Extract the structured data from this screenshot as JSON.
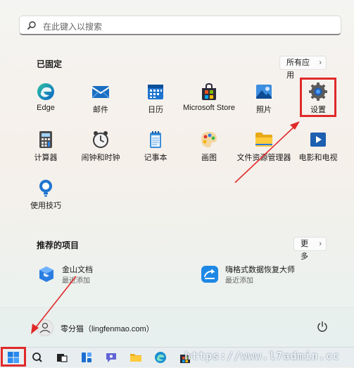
{
  "search": {
    "placeholder": "在此键入以搜索"
  },
  "pinned": {
    "title": "已固定",
    "all_apps_label": "所有应用",
    "apps": [
      {
        "label": "Edge",
        "icon": "edge-icon"
      },
      {
        "label": "邮件",
        "icon": "mail-icon"
      },
      {
        "label": "日历",
        "icon": "calendar-icon"
      },
      {
        "label": "Microsoft Store",
        "icon": "store-icon"
      },
      {
        "label": "照片",
        "icon": "photos-icon"
      },
      {
        "label": "设置",
        "icon": "settings-icon"
      },
      {
        "label": "计算器",
        "icon": "calculator-icon"
      },
      {
        "label": "闹钟和时钟",
        "icon": "clock-icon"
      },
      {
        "label": "记事本",
        "icon": "notepad-icon"
      },
      {
        "label": "画图",
        "icon": "paint-icon"
      },
      {
        "label": "文件资源管理器",
        "icon": "file-explorer-icon"
      },
      {
        "label": "电影和电视",
        "icon": "movies-tv-icon"
      },
      {
        "label": "使用技巧",
        "icon": "tips-icon"
      }
    ]
  },
  "recommended": {
    "title": "推荐的项目",
    "more_label": "更多",
    "items": [
      {
        "name": "金山文档",
        "sub": "最近添加",
        "icon": "kdocs-icon"
      },
      {
        "name": "嗨格式数据恢复大师",
        "sub": "最近添加",
        "icon": "data-recovery-icon"
      }
    ]
  },
  "footer": {
    "user_name": "零分猫（lingfenmao.com）"
  },
  "watermark": "https://www.l7admin.cc",
  "colors": {
    "highlight": "#e02a2a",
    "accent": "#0067c0"
  }
}
